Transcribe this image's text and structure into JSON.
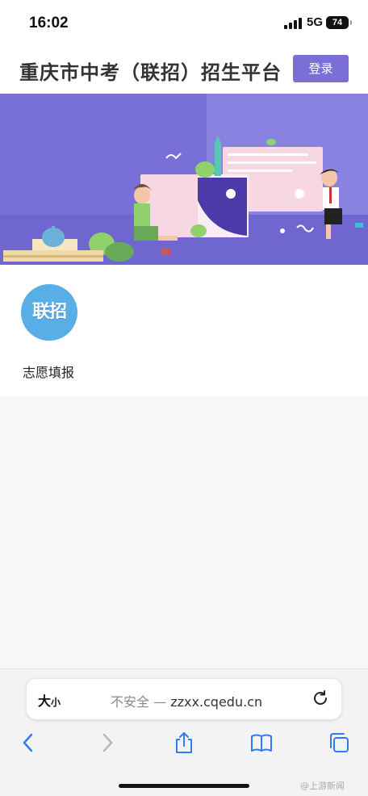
{
  "status_bar": {
    "time": "16:02",
    "network": "5G",
    "battery": "74"
  },
  "header": {
    "title": "重庆市中考（联招）招生平台",
    "login_label": "登录"
  },
  "banner": {
    "accent": "#7a70d8"
  },
  "apps": [
    {
      "icon_text": "联招",
      "label": "志愿填报",
      "color": "#5aaee8"
    }
  ],
  "browser": {
    "text_size": "大",
    "text_size_small": "小",
    "security_label": "不安全 —",
    "url": "zzxx.cqedu.cn"
  },
  "watermark": "@上游新闻",
  "colors": {
    "accent": "#7b6fd6",
    "toolbar_blue": "#2f7cf6"
  }
}
